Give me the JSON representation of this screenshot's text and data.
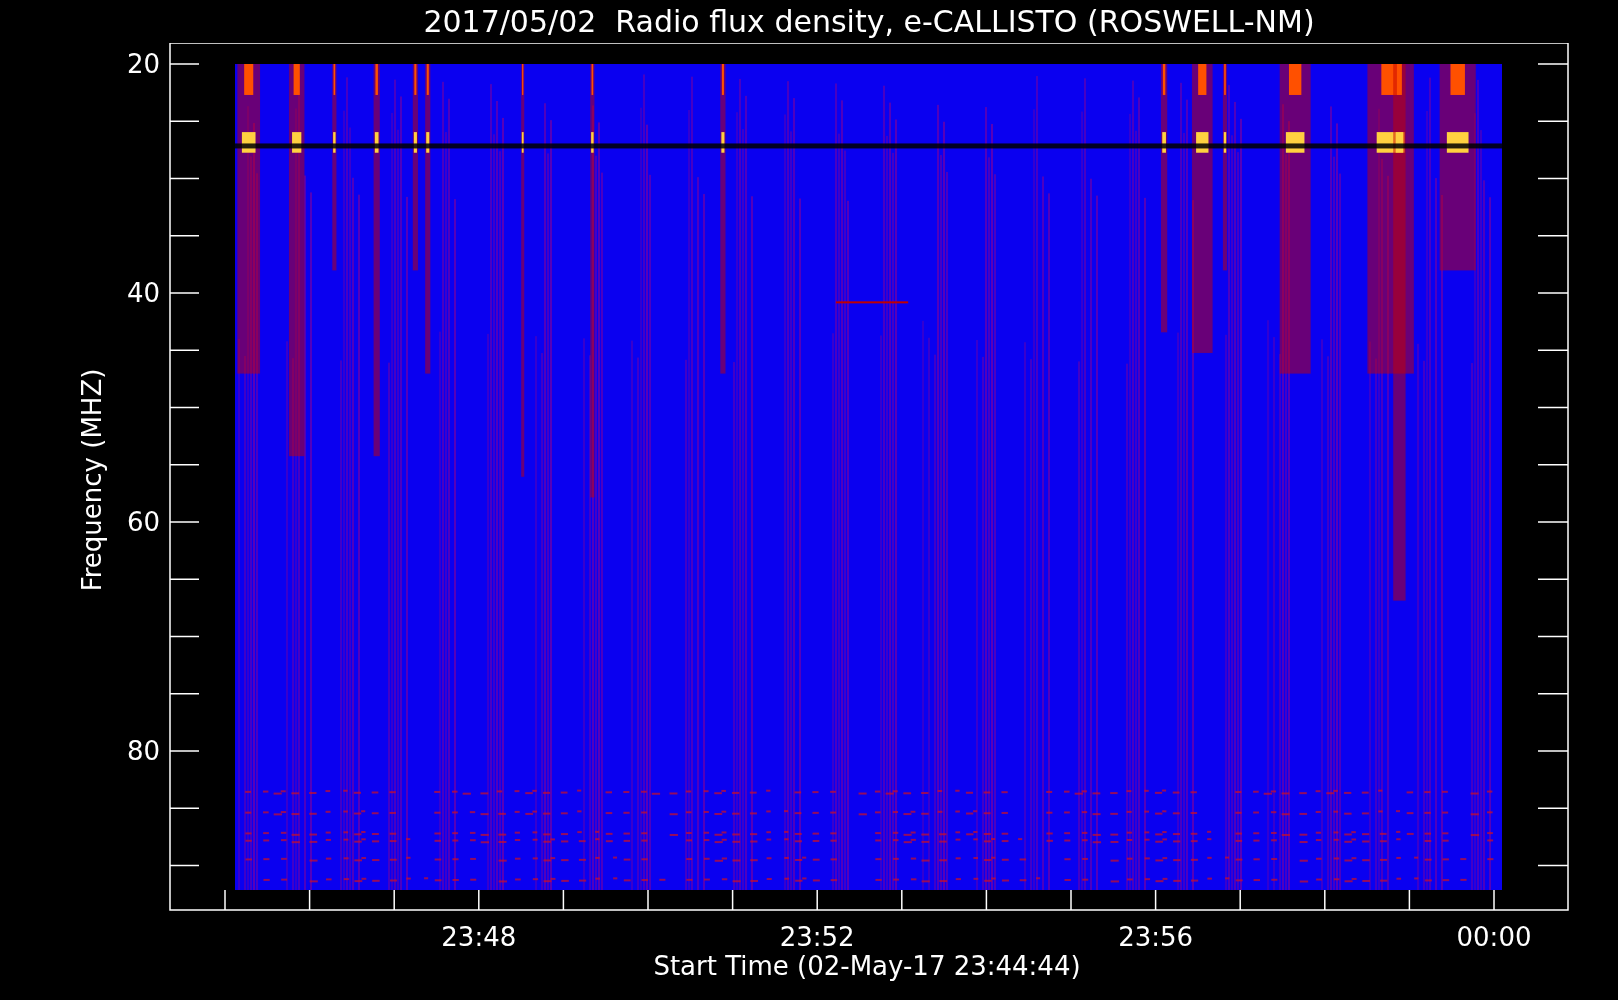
{
  "title": "2017/05/02  Radio flux density, e-CALLISTO (ROSWELL-NM)",
  "y_axis": {
    "label": "Frequency (MHZ)",
    "ticks": [
      "20",
      "40",
      "60",
      "80"
    ]
  },
  "x_axis": {
    "label": "Start Time (02-May-17 23:44:44)",
    "ticks": [
      "23:48",
      "23:52",
      "23:56",
      "00:00"
    ]
  }
}
